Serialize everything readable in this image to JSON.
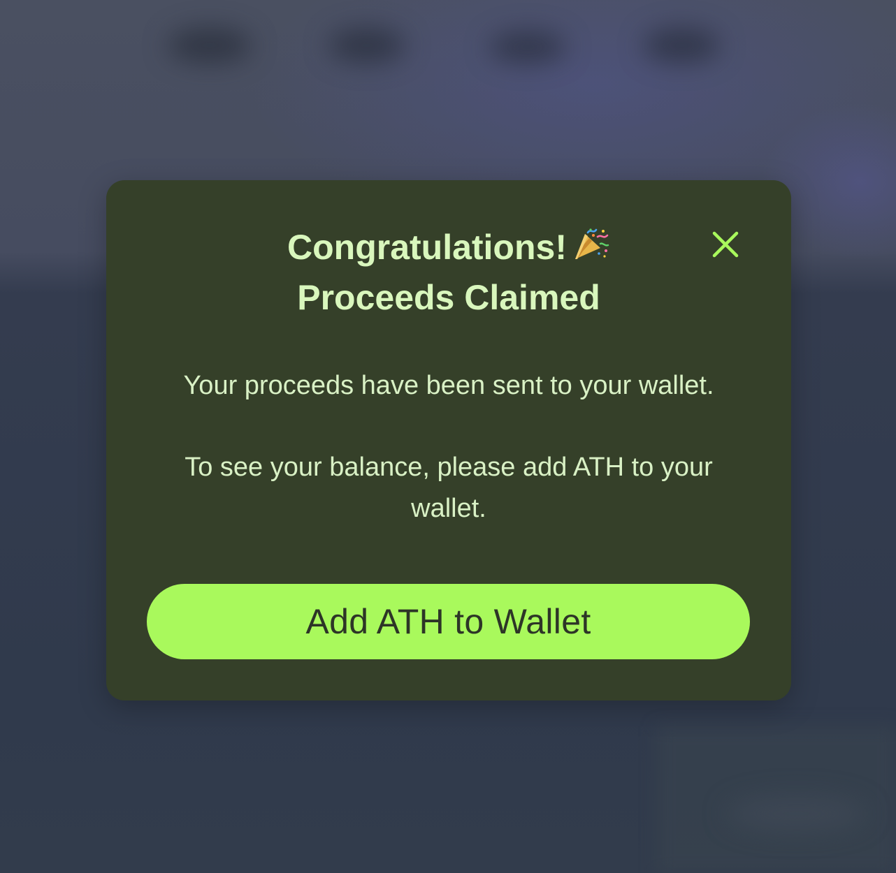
{
  "modal": {
    "title_line1": "Congratulations!",
    "title_line2": "Proceeds Claimed",
    "title_icon": "party-popper-icon",
    "close_icon": "close-icon",
    "message_1": "Your proceeds have been sent to your wallet.",
    "message_2": "To see your balance, please add ATH to your wallet.",
    "cta_label": "Add ATH to Wallet"
  },
  "colors": {
    "modal_background": "#354029",
    "accent": "#a9f95c",
    "title_text": "#d9f7bd",
    "body_text": "#d9f1c5",
    "button_text": "#2d3527"
  }
}
